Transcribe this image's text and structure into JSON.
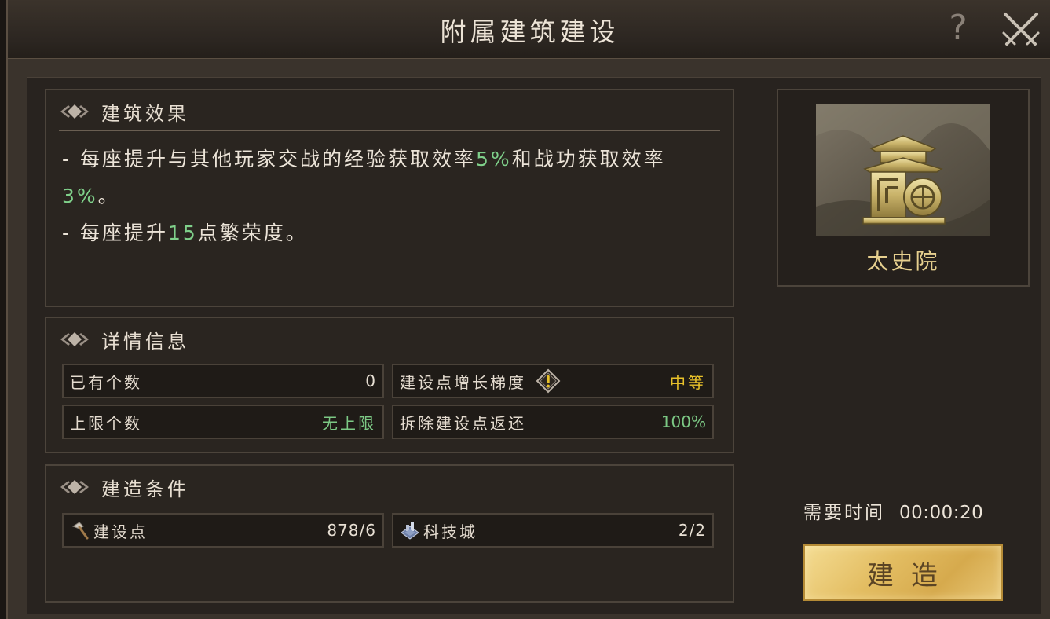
{
  "dialog": {
    "title": "附属建筑建设"
  },
  "effects": {
    "section_title": "建筑效果",
    "line1_pre": "- 每座提升与其他玩家交战的经验获取效率",
    "line1_val1": "5%",
    "line1_mid": "和战功获取效率",
    "line1_val2": "3%",
    "line1_end": "。",
    "line2_pre": "- 每座提升",
    "line2_val": "15",
    "line2_post": "点繁荣度。"
  },
  "details": {
    "section_title": "详情信息",
    "owned_label": "已有个数",
    "owned_value": "0",
    "growth_label": "建设点增长梯度",
    "growth_value": "中等",
    "limit_label": "上限个数",
    "limit_value": "无上限",
    "refund_label": "拆除建设点返还",
    "refund_value": "100%"
  },
  "conditions": {
    "section_title": "建造条件",
    "points_label": "建设点",
    "points_value": "878/6",
    "tech_label": "科技城",
    "tech_value": "2/2"
  },
  "building": {
    "name": "太史院"
  },
  "build": {
    "time_label": "需要时间",
    "time_value": "00:00:20",
    "button_label": "建造"
  },
  "colors": {
    "accent_green": "#7fd08a",
    "accent_yellow": "#e8c12a",
    "button_gold": "#e3bd62",
    "building_name": "#e6cf8e"
  },
  "icons": [
    "help-icon",
    "crossed-swords-close-icon",
    "diamond-ornament-icon",
    "exclamation-info-icon",
    "hammer-icon",
    "tech-city-icon"
  ]
}
